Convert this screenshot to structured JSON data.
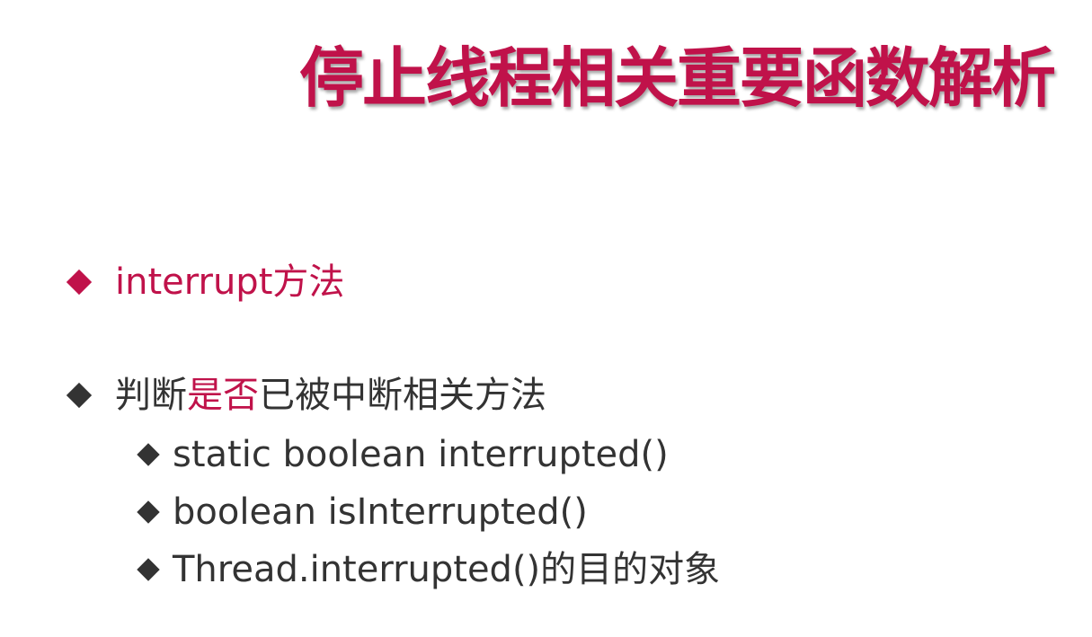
{
  "slide": {
    "title": "停止线程相关重要函数解析",
    "bullets": [
      {
        "text": "interrupt方法"
      },
      {
        "parts": [
          "判断",
          "是否",
          "已被中断相关方法"
        ],
        "sub_items": [
          "static boolean interrupted()",
          "boolean isInterrupted()",
          "Thread.interrupted()的目的对象"
        ]
      }
    ]
  },
  "colors": {
    "accent": "#c0124a",
    "text": "#333333",
    "background": "#ffffff"
  },
  "icons": {
    "bullet": "diamond-bullet-icon"
  }
}
